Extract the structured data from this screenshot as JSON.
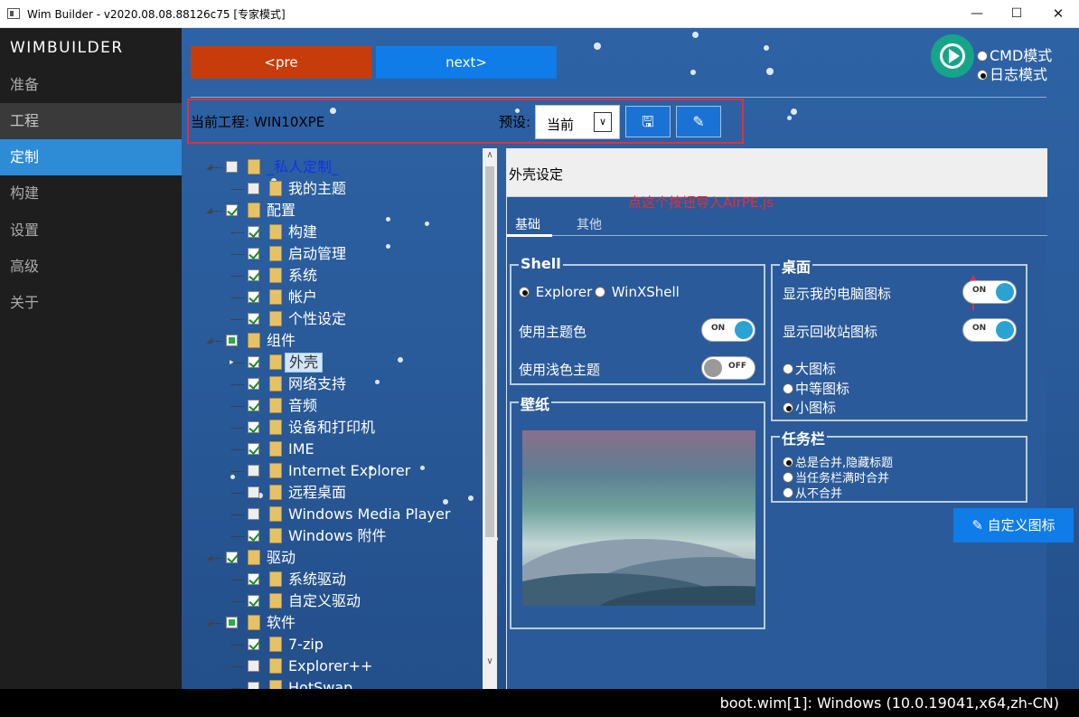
{
  "window": {
    "title": "Wim Builder - v2020.08.08.88126c75 [专家模式]"
  },
  "sidebar": {
    "brand": "WIMBUILDER",
    "items": [
      {
        "label": "准备"
      },
      {
        "label": "工程"
      },
      {
        "label": "定制"
      },
      {
        "label": "构建"
      },
      {
        "label": "设置"
      },
      {
        "label": "高级"
      },
      {
        "label": "关于"
      }
    ],
    "active": "定制"
  },
  "nav": {
    "prev": "<pre",
    "next": "next>"
  },
  "mode": {
    "cmd": "CMD模式",
    "log": "日志模式",
    "selected": "日志模式"
  },
  "project": {
    "label": "当前工程: WIN10XPE",
    "preset_label": "预设:",
    "preset_value": "当前"
  },
  "annotation": "点这个按钮导入AIrPE.js",
  "tree": [
    {
      "label": "_私人定制_",
      "state": "empty",
      "level": 0
    },
    {
      "label": "我的主题",
      "state": "empty",
      "level": 1
    },
    {
      "label": "配置",
      "state": "checked",
      "level": 0
    },
    {
      "label": "构建",
      "state": "checked",
      "level": 1
    },
    {
      "label": "启动管理",
      "state": "checked",
      "level": 1
    },
    {
      "label": "系统",
      "state": "checked",
      "level": 1
    },
    {
      "label": "帐户",
      "state": "checked",
      "level": 1
    },
    {
      "label": "个性设定",
      "state": "checked",
      "level": 1
    },
    {
      "label": "组件",
      "state": "partial",
      "level": 0
    },
    {
      "label": "外壳",
      "state": "checked",
      "level": 1
    },
    {
      "label": "网络支持",
      "state": "checked",
      "level": 1
    },
    {
      "label": "音频",
      "state": "checked",
      "level": 1
    },
    {
      "label": "设备和打印机",
      "state": "checked",
      "level": 1
    },
    {
      "label": "IME",
      "state": "checked",
      "level": 1
    },
    {
      "label": "Internet Explorer",
      "state": "empty",
      "level": 1
    },
    {
      "label": "远程桌面",
      "state": "empty",
      "level": 1
    },
    {
      "label": "Windows Media Player",
      "state": "empty",
      "level": 1
    },
    {
      "label": "Windows 附件",
      "state": "checked",
      "level": 1
    },
    {
      "label": "驱动",
      "state": "checked",
      "level": 0
    },
    {
      "label": "系统驱动",
      "state": "checked",
      "level": 1
    },
    {
      "label": "自定义驱动",
      "state": "checked",
      "level": 1
    },
    {
      "label": "软件",
      "state": "partial",
      "level": 0
    },
    {
      "label": "7-zip",
      "state": "checked",
      "level": 1
    },
    {
      "label": "Explorer++",
      "state": "empty",
      "level": 1
    },
    {
      "label": "HotSwap",
      "state": "empty",
      "level": 1
    }
  ],
  "panel": {
    "title": "外壳设定",
    "tabs": [
      "基础",
      "其他"
    ],
    "shell": {
      "title": "Shell",
      "opt_explorer": "Explorer",
      "opt_winxshell": "WinXShell",
      "theme_color": "使用主题色",
      "light_theme": "使用浅色主题",
      "theme_color_state": "ON",
      "light_theme_state": "OFF"
    },
    "wallpaper": {
      "title": "壁纸"
    },
    "desktop": {
      "title": "桌面",
      "show_computer": "显示我的电脑图标",
      "show_recycle": "显示回收站图标",
      "show_computer_state": "ON",
      "show_recycle_state": "ON",
      "icon_large": "大图标",
      "icon_medium": "中等图标",
      "icon_small": "小图标"
    },
    "taskbar": {
      "title": "任务栏",
      "opt1": "总是合并,隐藏标题",
      "opt2": "当任务栏满时合并",
      "opt3": "从不合并"
    },
    "custom_icon_button": "自定义图标"
  },
  "status": "boot.wim[1]: Windows (10.0.19041,x64,zh-CN)",
  "colors": {
    "accent": "#2e8bd6",
    "prev": "#c83c0c",
    "next": "#0f7ce8",
    "annotation": "#e0303e"
  }
}
